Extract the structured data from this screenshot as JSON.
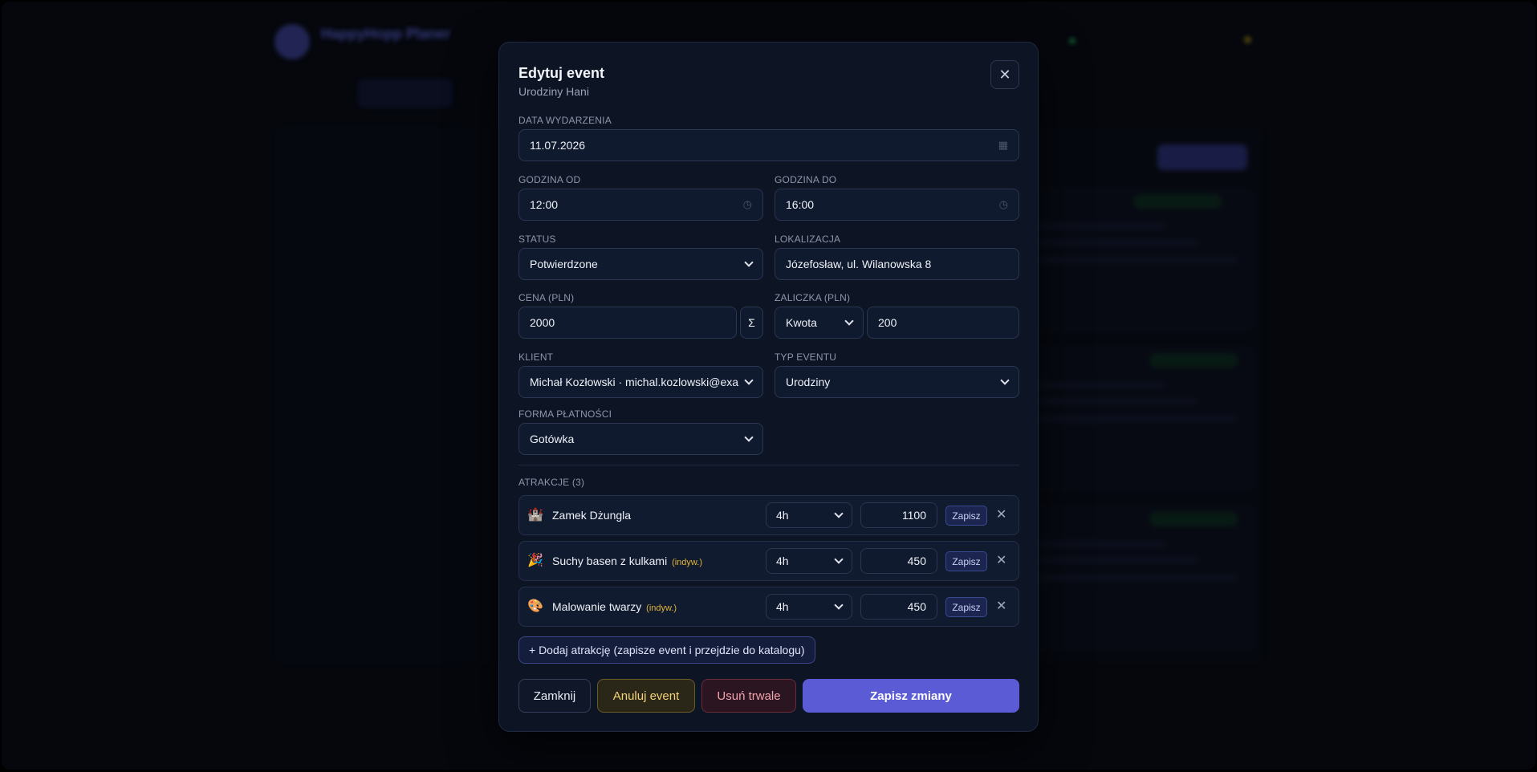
{
  "background": {
    "app_title": "HappyHopp",
    "app_title_accent": "Planer"
  },
  "modal": {
    "title": "Edytuj event",
    "subtitle": "Urodziny Hani",
    "close_icon": "close-icon",
    "fields": {
      "date": {
        "label": "DATA WYDARZENIA",
        "value": "11.07.2026"
      },
      "time_from": {
        "label": "GODZINA OD",
        "value": "12:00"
      },
      "time_to": {
        "label": "GODZINA DO",
        "value": "16:00"
      },
      "status": {
        "label": "STATUS",
        "value": "Potwierdzone"
      },
      "location": {
        "label": "LOKALIZACJA",
        "value": "Józefosław, ul. Wilanowska 8"
      },
      "price": {
        "label": "CENA (PLN)",
        "value": "2000",
        "sum_symbol": "Σ"
      },
      "deposit": {
        "label": "ZALICZKA (PLN)",
        "type": "Kwota",
        "value": "200"
      },
      "client": {
        "label": "KLIENT",
        "value": "Michał Kozłowski · michal.kozlowski@example.com"
      },
      "event_type": {
        "label": "TYP EVENTU",
        "value": "Urodziny"
      },
      "payment": {
        "label": "FORMA PŁATNOŚCI",
        "value": "Gotówka"
      }
    },
    "attractions": {
      "header": "ATRAKCJE (3)",
      "items": [
        {
          "emoji": "🏰",
          "name": "Zamek Dżungla",
          "tag": "",
          "duration": "4h",
          "price": "1100",
          "save": "Zapisz"
        },
        {
          "emoji": "🎉",
          "name": "Suchy basen z kulkami",
          "tag": "(indyw.)",
          "duration": "4h",
          "price": "450",
          "save": "Zapisz"
        },
        {
          "emoji": "🎨",
          "name": "Malowanie twarzy",
          "tag": "(indyw.)",
          "duration": "4h",
          "price": "450",
          "save": "Zapisz"
        }
      ],
      "add_label": "+ Dodaj atrakcję (zapisze event i przejdzie do katalogu)"
    },
    "buttons": {
      "close": "Zamknij",
      "cancel_event": "Anuluj event",
      "delete": "Usuń trwale",
      "save": "Zapisz zmiany"
    }
  },
  "colors": {
    "accent": "#5b5bd6",
    "warning": "#f3d37a",
    "danger": "#f2a3b0"
  }
}
